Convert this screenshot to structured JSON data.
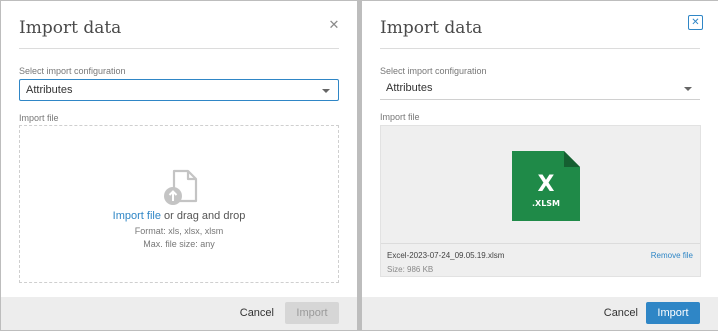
{
  "colors": {
    "accent": "#2f86c6",
    "excel_green": "#1f8a48",
    "excel_dark": "#155f31"
  },
  "dialog_empty": {
    "title": "Import data",
    "close_icon": "close-icon",
    "config_label": "Select import configuration",
    "config_value": "Attributes",
    "file_label": "Import file",
    "upload_icon": "file-upload-icon",
    "drop_link": "Import file",
    "drop_text": " or drag and drop",
    "format_text": "Format: xls, xlsx, xlsm",
    "max_size_text": "Max. file size: any",
    "cancel_label": "Cancel",
    "import_label": "Import",
    "import_enabled": false
  },
  "dialog_loaded": {
    "title": "Import data",
    "close_icon": "close-icon",
    "config_label": "Select import configuration",
    "config_value": "Attributes",
    "file_label": "Import file",
    "file_icon": "excel-file-icon",
    "file_icon_letter": "X",
    "file_icon_ext": ".XLSM",
    "file_name": "Excel-2023-07-24_09.05.19.xlsm",
    "file_size": "Size: 986 KB",
    "remove_label": "Remove file",
    "cancel_label": "Cancel",
    "import_label": "Import",
    "import_enabled": true
  }
}
